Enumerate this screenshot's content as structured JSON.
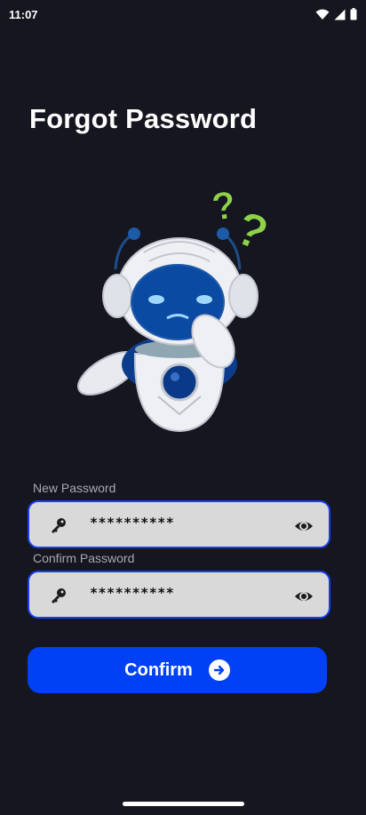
{
  "status_bar": {
    "time": "11:07"
  },
  "header": {
    "title": "Forgot Password"
  },
  "form": {
    "new_password": {
      "label": "New Password",
      "value": "**********"
    },
    "confirm_password": {
      "label": "Confirm Password",
      "value": "**********"
    },
    "confirm_button_label": "Confirm"
  },
  "colors": {
    "background": "#15161f",
    "accent": "#0041f5",
    "field_border": "#1a3ff0",
    "question_marks": "#8fd24a"
  },
  "icons": [
    "wifi-icon",
    "signal-icon",
    "battery-icon",
    "key-icon",
    "eye-icon",
    "arrow-right-icon"
  ]
}
